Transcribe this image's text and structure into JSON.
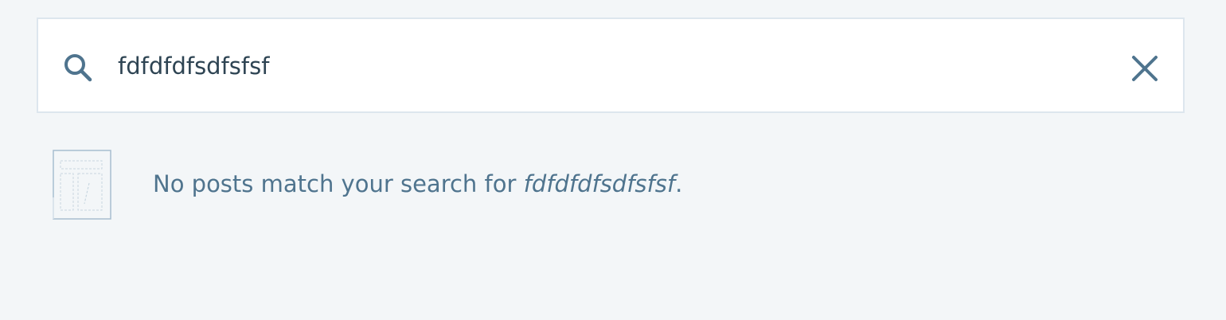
{
  "search": {
    "value": "fdfdfdfsdfsfsf",
    "icon": "search-icon",
    "clear_icon": "close-icon"
  },
  "empty_state": {
    "message_prefix": "No posts match your search for ",
    "query": "fdfdfdfsdfsfsf",
    "message_suffix": ".",
    "illustration_icon": "empty-document-icon"
  },
  "colors": {
    "background": "#f3f6f8",
    "text_primary": "#2e4453",
    "text_secondary": "#4f748e",
    "border": "#dde6ee"
  }
}
